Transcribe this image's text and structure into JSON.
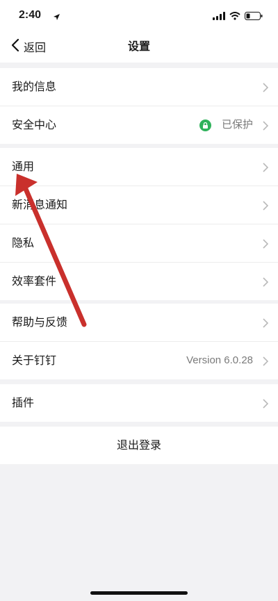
{
  "status_bar": {
    "time": "2:40"
  },
  "nav": {
    "back_label": "返回",
    "title": "设置"
  },
  "group1": [
    {
      "label": "我的信息"
    },
    {
      "label": "安全中心",
      "value": "已保护"
    }
  ],
  "group2": [
    {
      "label": "通用"
    },
    {
      "label": "新消息通知"
    },
    {
      "label": "隐私"
    },
    {
      "label": "效率套件"
    }
  ],
  "group3": [
    {
      "label": "帮助与反馈"
    },
    {
      "label": "关于钉钉",
      "value": "Version 6.0.28"
    }
  ],
  "group4": [
    {
      "label": "插件"
    }
  ],
  "logout_label": "退出登录",
  "colors": {
    "accent_green": "#2fb25b",
    "arrow_red": "#c9302c"
  },
  "icons": [
    "location-arrow-icon",
    "signal-icon",
    "wifi-icon",
    "battery-icon",
    "back-chevron-icon",
    "lock-icon",
    "chevron-right-icon"
  ]
}
